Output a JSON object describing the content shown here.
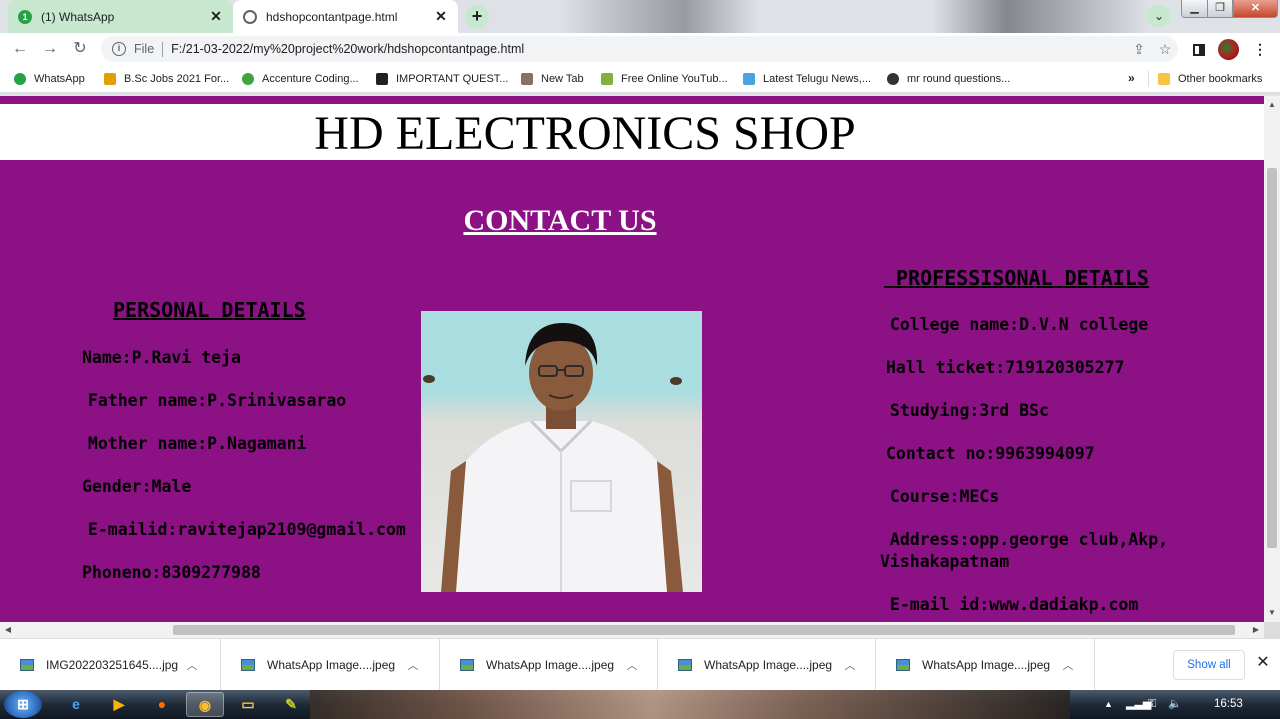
{
  "browser": {
    "tabs": [
      {
        "favicon": "1",
        "title": "(1) WhatsApp"
      },
      {
        "favicon": "",
        "title": "hdshopcontantpage.html"
      }
    ],
    "omnibox": {
      "scheme": "File",
      "url": "F:/21-03-2022/my%20project%20work/hdshopcontantpage.html"
    },
    "bookmarks": [
      {
        "label": "WhatsApp",
        "color": "#25a244"
      },
      {
        "label": "B.Sc Jobs 2021 For...",
        "color": "#e0a100"
      },
      {
        "label": "Accenture Coding...",
        "color": "#3fa33f"
      },
      {
        "label": "IMPORTANT QUEST...",
        "color": "#222222"
      },
      {
        "label": "New Tab",
        "color": "#8d6e63"
      },
      {
        "label": "Free Online YouTub...",
        "color": "#7cb342"
      },
      {
        "label": "Latest Telugu News,...",
        "color": "#4aa3df"
      },
      {
        "label": "mr round questions...",
        "color": "#333333"
      }
    ],
    "bookmarks_more": "»",
    "other_bookmarks": "Other bookmarks"
  },
  "page": {
    "site_title": "HD ELECTRONICS SHOP",
    "contact_title": "CONTACT US",
    "background_color": "#8c1185",
    "personal": {
      "heading": "PERSONAL DETAILS",
      "lines": [
        "Name:P.Ravi teja",
        " Father name:P.Srinivasarao",
        " Mother name:P.Nagamani",
        "Gender:Male",
        " E-mailid:ravitejap2109@gmail.com",
        "Phoneno:8309277988"
      ]
    },
    "professional": {
      "heading": " PROFESSISONAL DETAILS",
      "lines": [
        " College name:D.V.N college",
        "Hall ticket:719120305277",
        " Studying:3rd BSc",
        "Contact no:9963994097",
        " Course:MECs",
        " Address:opp.george club,Akp,",
        "Vishakapatnam",
        " E-mail id:www.dadiakp.com"
      ]
    }
  },
  "downloads": {
    "items": [
      "IMG202203251645....jpg",
      "WhatsApp Image....jpeg",
      "WhatsApp Image....jpeg",
      "WhatsApp Image....jpeg",
      "WhatsApp Image....jpeg"
    ],
    "show_all": "Show all"
  },
  "taskbar": {
    "clock": "16:53"
  }
}
